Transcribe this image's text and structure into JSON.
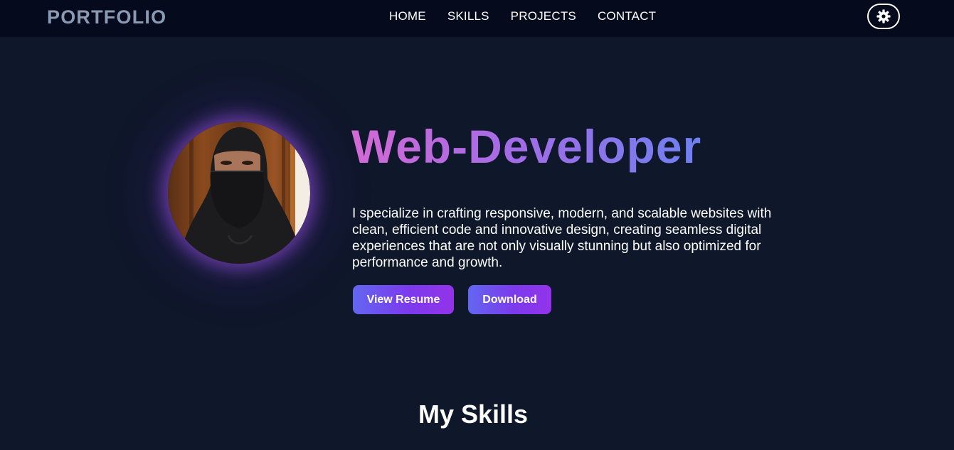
{
  "nav": {
    "logo": "PORTFOLIO",
    "links": [
      "HOME",
      "SKILLS",
      "PROJECTS",
      "CONTACT"
    ],
    "theme_toggle_icon": "gear-icon"
  },
  "hero": {
    "title": "Web-Developer",
    "description": "I specialize in crafting responsive, modern, and scalable websites with clean, efficient code and innovative design, creating seamless digital experiences that are not only visually stunning but also optimized for performance and growth.",
    "buttons": {
      "resume": "View Resume",
      "download": "Download"
    }
  },
  "skills": {
    "heading": "My Skills"
  },
  "colors": {
    "background": "#0f172a",
    "navbar": "#050b1d",
    "logo": "#8a9ab3",
    "accent_start": "#6366f1",
    "accent_end": "#9333ea",
    "title_gradient": [
      "#d36ad6",
      "#a46be6",
      "#6e80f0"
    ]
  }
}
